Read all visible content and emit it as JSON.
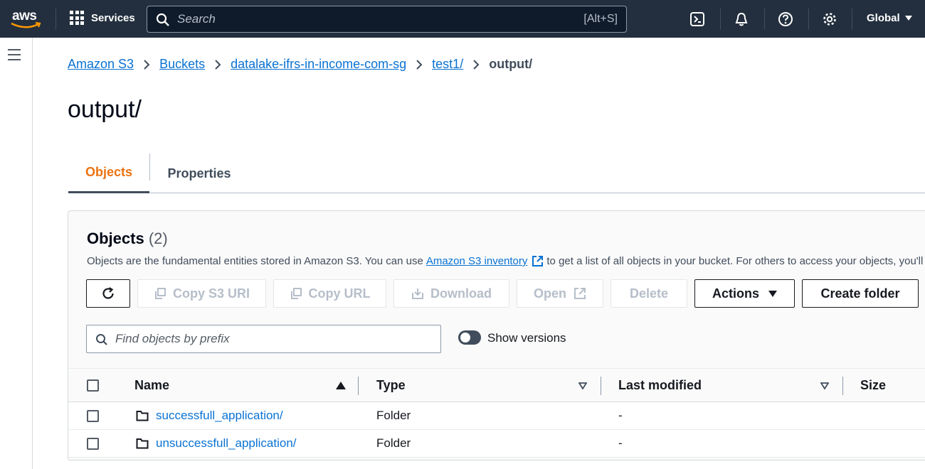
{
  "topnav": {
    "logo_text": "aws",
    "services_label": "Services",
    "search_placeholder": "Search",
    "search_shortcut": "[Alt+S]",
    "region_label": "Global"
  },
  "breadcrumb": {
    "items": [
      "Amazon S3",
      "Buckets",
      "datalake-ifrs-in-income-com-sg",
      "test1/"
    ],
    "current": "output/"
  },
  "page_title": "output/",
  "tabs": [
    {
      "label": "Objects",
      "active": true
    },
    {
      "label": "Properties",
      "active": false
    }
  ],
  "objects_panel": {
    "title": "Objects",
    "count": "(2)",
    "description_before": "Objects are the fundamental entities stored in Amazon S3. You can use",
    "description_link": "Amazon S3 inventory",
    "description_after": "to get a list of all objects in your bucket. For others to access your objects, you'll need to explicitly grant them permissions.",
    "buttons": {
      "copy_s3_uri": "Copy S3 URI",
      "copy_url": "Copy URL",
      "download": "Download",
      "open": "Open",
      "delete": "Delete",
      "actions": "Actions",
      "create_folder": "Create folder"
    },
    "find_placeholder": "Find objects by prefix",
    "show_versions_label": "Show versions"
  },
  "table": {
    "headers": {
      "name": "Name",
      "type": "Type",
      "last_modified": "Last modified",
      "size": "Size"
    },
    "rows": [
      {
        "name": "successfull_application/",
        "type": "Folder",
        "last_modified": "-"
      },
      {
        "name": "unsuccessfull_application/",
        "type": "Folder",
        "last_modified": "-"
      }
    ]
  },
  "colors": {
    "nav_bg": "#232f3e",
    "link": "#0972d3",
    "active_tab": "#ec7211",
    "aws_smile": "#ff9900"
  }
}
